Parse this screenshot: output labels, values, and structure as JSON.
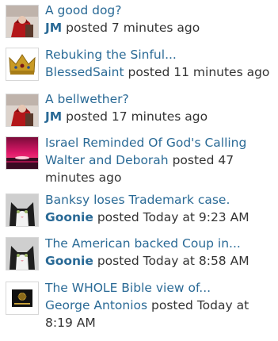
{
  "feed": {
    "items": [
      {
        "title": "A good dog?",
        "author": "JM",
        "action": " posted ",
        "time": "7 minutes ago",
        "avatar_icon": "avatar-red-figure-icon"
      },
      {
        "title": "Rebuking the Sinful...",
        "author": "BlessedSaint",
        "action": " posted ",
        "time": "11 minutes ago",
        "avatar_icon": "crown-icon"
      },
      {
        "title": "A bellwether?",
        "author": "JM",
        "action": " posted ",
        "time": "17 minutes ago",
        "avatar_icon": "avatar-red-figure-icon"
      },
      {
        "title": "Israel Reminded Of God's Calling",
        "author": "Walter and Deborah",
        "action": " posted ",
        "time": "47 minutes ago",
        "avatar_icon": "sunset-icon"
      },
      {
        "title": "Banksy loses Trademark case.",
        "author": "Goonie",
        "action": " posted ",
        "time": "Today at 9:23 AM",
        "avatar_icon": "cat-icon"
      },
      {
        "title": "The American backed Coup in...",
        "author": "Goonie",
        "action": " posted ",
        "time": "Today at 8:58 AM",
        "avatar_icon": "cat-icon"
      },
      {
        "title": "The WHOLE Bible view of...",
        "author": "George Antonios",
        "action": " posted ",
        "time": "Today at 8:19 AM",
        "avatar_icon": "book-emblem-icon"
      }
    ]
  },
  "colors": {
    "link": "#2a6a96",
    "text": "#333333",
    "thumb_border": "#d7d7d7"
  }
}
